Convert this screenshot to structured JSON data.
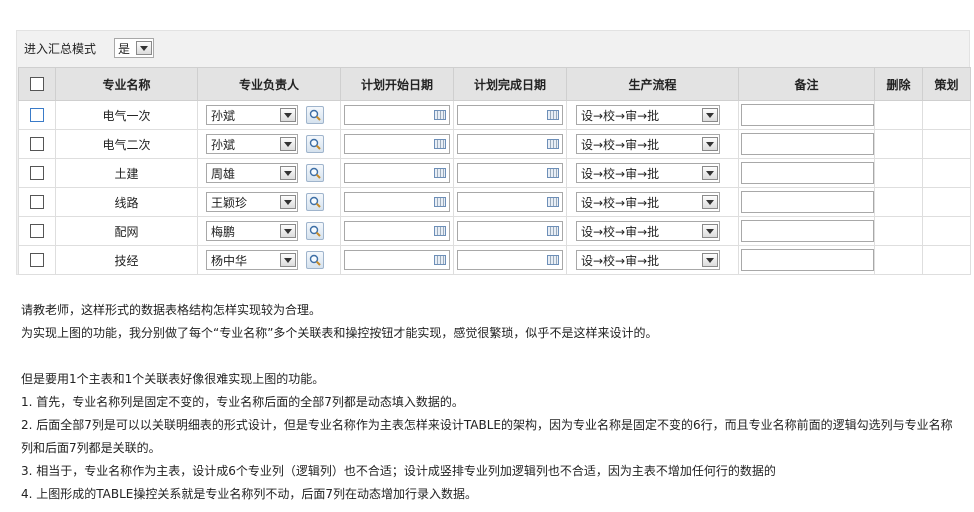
{
  "mode": {
    "label": "进入汇总模式",
    "value": "是"
  },
  "headers": [
    "专业名称",
    "专业负责人",
    "计划开始日期",
    "计划完成日期",
    "生产流程",
    "备注",
    "删除",
    "策划"
  ],
  "rows": [
    {
      "name": "电气一次",
      "person": "孙斌",
      "flow": "设→校→审→批"
    },
    {
      "name": "电气二次",
      "person": "孙斌",
      "flow": "设→校→审→批"
    },
    {
      "name": "土建",
      "person": "周雄",
      "flow": "设→校→审→批"
    },
    {
      "name": "线路",
      "person": "王颖珍",
      "flow": "设→校→审→批"
    },
    {
      "name": "配网",
      "person": "梅鹏",
      "flow": "设→校→审→批"
    },
    {
      "name": "技经",
      "person": "杨中华",
      "flow": "设→校→审→批"
    }
  ],
  "paragraphs": [
    "请教老师，这样形式的数据表格结构怎样实现较为合理。",
    "为实现上图的功能，我分别做了每个“专业名称”多个关联表和操控按钮才能实现，感觉很繁琐，似乎不是这样来设计的。",
    "",
    "但是要用1个主表和1个关联表好像很难实现上图的功能。",
    "1. 首先，专业名称列是固定不变的，专业名称后面的全部7列都是动态填入数据的。",
    "2. 后面全部7列是可以以关联明细表的形式设计，但是专业名称作为主表怎样来设计TABLE的架构，因为专业名称是固定不变的6行，而且专业名称前面的逻辑勾选列与专业名称列和后面7列都是关联的。",
    "3. 相当于，专业名称作为主表，设计成6个专业列（逻辑列）也不合适；设计成竖排专业列加逻辑列也不合适，因为主表不增加任何行的数据的",
    "4. 上图形成的TABLE操控关系就是专业名称列不动，后面7列在动态增加行录入数据。"
  ]
}
